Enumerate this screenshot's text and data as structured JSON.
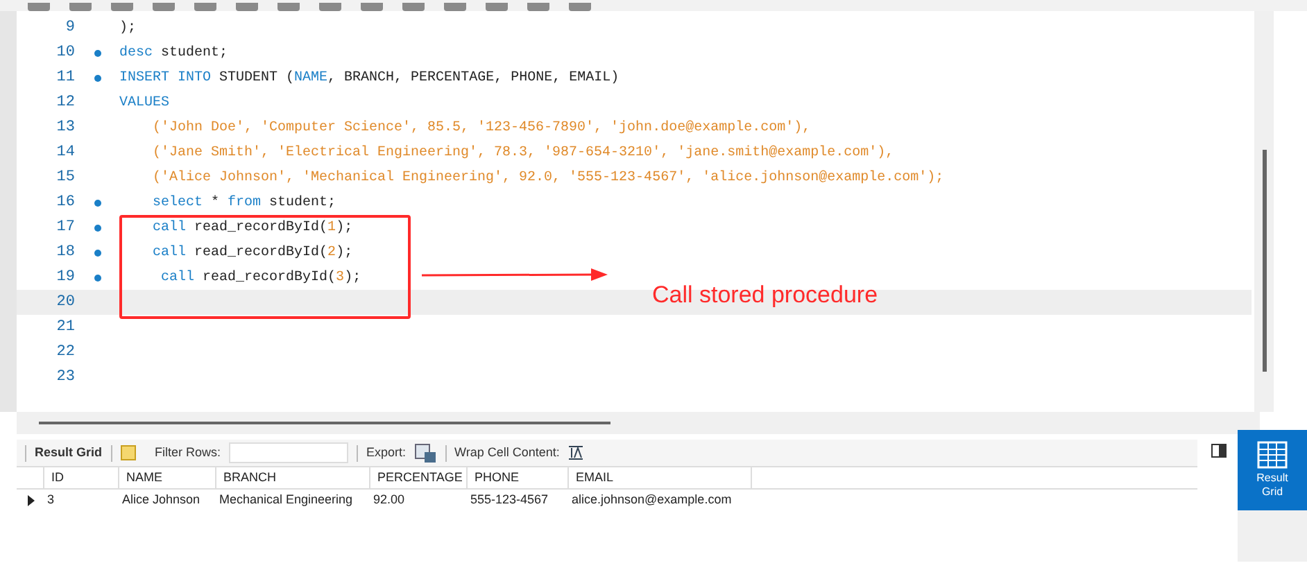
{
  "editor": {
    "lines": [
      {
        "number": "9",
        "marker": false,
        "current": false,
        "tokens": [
          {
            "kind": "text",
            "text": ");"
          }
        ]
      },
      {
        "number": "10",
        "marker": true,
        "current": false,
        "tokens": [
          {
            "kind": "keyword",
            "text": "desc"
          },
          {
            "kind": "text",
            "text": " student;"
          }
        ]
      },
      {
        "number": "11",
        "marker": true,
        "current": false,
        "tokens": [
          {
            "kind": "keyword",
            "text": "INSERT INTO"
          },
          {
            "kind": "text",
            "text": " STUDENT ("
          },
          {
            "kind": "keyword",
            "text": "NAME"
          },
          {
            "kind": "text",
            "text": ", BRANCH, PERCENTAGE, PHONE, EMAIL)"
          }
        ]
      },
      {
        "number": "12",
        "marker": false,
        "current": false,
        "tokens": [
          {
            "kind": "keyword",
            "text": "VALUES"
          }
        ]
      },
      {
        "number": "13",
        "marker": false,
        "current": false,
        "tokens": [
          {
            "kind": "string",
            "text": "    ('John Doe', 'Computer Science', 85.5, '123-456-7890', 'john.doe@example.com'),"
          }
        ]
      },
      {
        "number": "14",
        "marker": false,
        "current": false,
        "tokens": [
          {
            "kind": "string",
            "text": "    ('Jane Smith', 'Electrical Engineering', 78.3, '987-654-3210', 'jane.smith@example.com'),"
          }
        ]
      },
      {
        "number": "15",
        "marker": false,
        "current": false,
        "tokens": [
          {
            "kind": "string",
            "text": "    ('Alice Johnson', 'Mechanical Engineering', 92.0, '555-123-4567', 'alice.johnson@example.com');"
          }
        ]
      },
      {
        "number": "16",
        "marker": true,
        "current": false,
        "tokens": [
          {
            "kind": "keyword",
            "text": "    select"
          },
          {
            "kind": "text",
            "text": " * "
          },
          {
            "kind": "keyword",
            "text": "from"
          },
          {
            "kind": "text",
            "text": " student;"
          }
        ]
      },
      {
        "number": "17",
        "marker": true,
        "current": false,
        "tokens": [
          {
            "kind": "keyword",
            "text": "    call"
          },
          {
            "kind": "text",
            "text": " read_recordById("
          },
          {
            "kind": "number",
            "text": "1"
          },
          {
            "kind": "text",
            "text": ");"
          }
        ]
      },
      {
        "number": "18",
        "marker": true,
        "current": false,
        "tokens": [
          {
            "kind": "keyword",
            "text": "    call"
          },
          {
            "kind": "text",
            "text": " read_recordById("
          },
          {
            "kind": "number",
            "text": "2"
          },
          {
            "kind": "text",
            "text": ");"
          }
        ]
      },
      {
        "number": "19",
        "marker": true,
        "current": false,
        "tokens": [
          {
            "kind": "keyword",
            "text": "     call"
          },
          {
            "kind": "text",
            "text": " read_recordById("
          },
          {
            "kind": "number",
            "text": "3"
          },
          {
            "kind": "text",
            "text": ");"
          }
        ]
      },
      {
        "number": "20",
        "marker": false,
        "current": true
      },
      {
        "number": "21",
        "marker": false,
        "current": false
      },
      {
        "number": "22",
        "marker": false,
        "current": false
      },
      {
        "number": "23",
        "marker": false,
        "current": false
      }
    ]
  },
  "annotation": {
    "text": "Call stored procedure"
  },
  "result_toolbar": {
    "result_grid": "Result Grid",
    "filter_label": "Filter Rows:",
    "export_label": "Export:",
    "wrap_label": "Wrap Cell Content:"
  },
  "table": {
    "columns": [
      "ID",
      "NAME",
      "BRANCH",
      "PERCENTAGE",
      "PHONE",
      "EMAIL"
    ],
    "rows": [
      {
        "selected": true,
        "cells": [
          "3",
          "Alice Johnson",
          "Mechanical Engineering",
          "92.00",
          "555-123-4567",
          "alice.johnson@example.com"
        ]
      }
    ]
  },
  "side_panel": {
    "tabs": [
      {
        "label": "Result Grid",
        "selected": true
      }
    ]
  }
}
